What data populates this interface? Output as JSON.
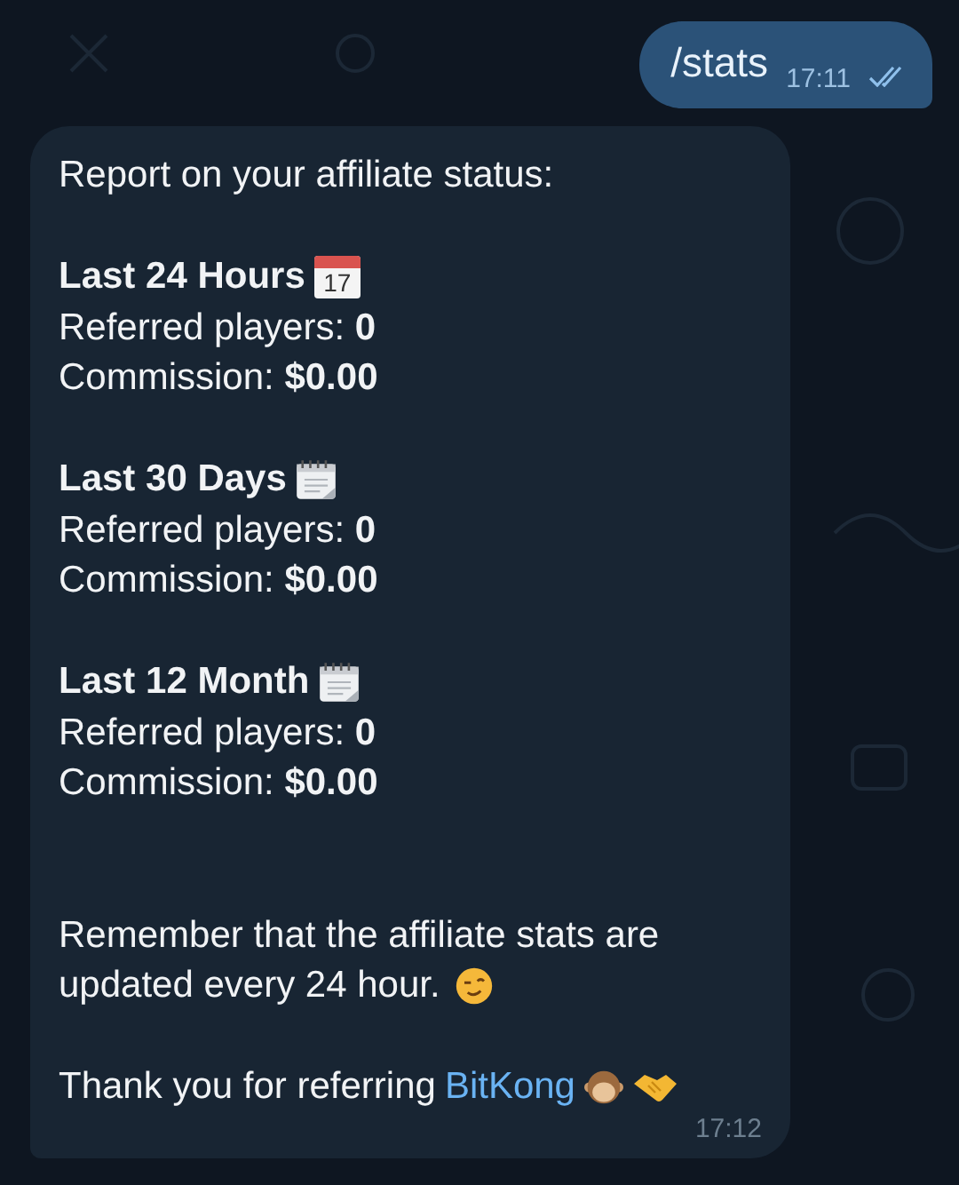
{
  "outgoing": {
    "text": "/stats",
    "time": "17:11",
    "read": true
  },
  "incoming": {
    "intro": "Report on your affiliate status:",
    "sections": [
      {
        "title": "Last 24 Hours",
        "kind": "dated",
        "day": "17",
        "lines": [
          "Referred players: **0**",
          "Commission: **$0.00**"
        ]
      },
      {
        "title": "Last 30 Days",
        "kind": "spiral",
        "lines": [
          "Referred players: **0**",
          "Commission: **$0.00**"
        ]
      },
      {
        "title": "Last 12 Month",
        "kind": "spiral",
        "lines": [
          "Referred players: **0**",
          "Commission: **$0.00**"
        ]
      }
    ],
    "note": [
      "Remember that the affiliate stats are",
      "updated every 24 hour."
    ],
    "thanks": "Thank you for referring",
    "link": "BitKong",
    "time": "17:12"
  }
}
